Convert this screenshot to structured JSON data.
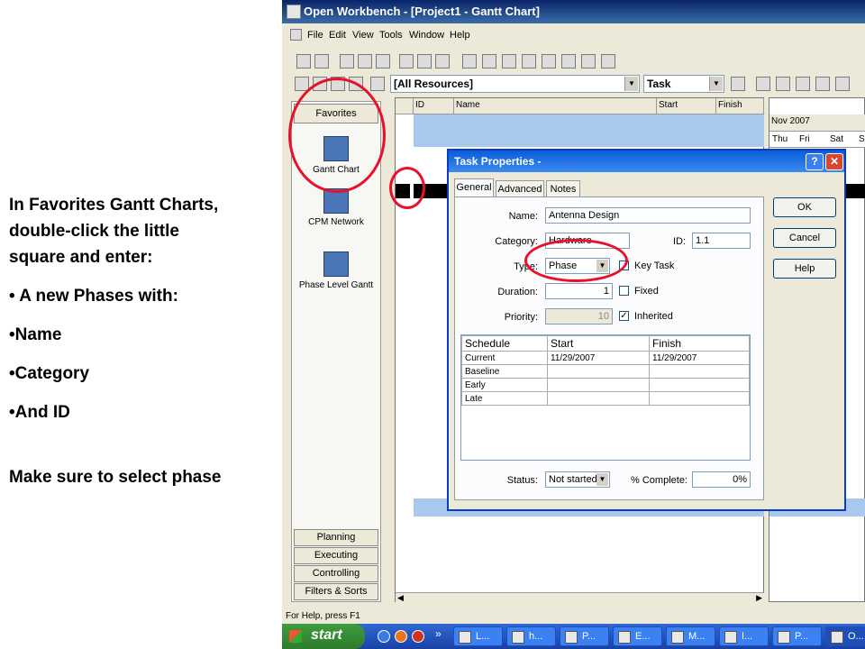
{
  "slide": {
    "line1": "In Favorites Gantt Charts,",
    "line2": "double-click the little",
    "line3": "square and enter:",
    "bullet1": "• A new Phases with:",
    "bullet2": "•Name",
    "bullet3": "•Category",
    "bullet4": "•And ID",
    "note": "Make sure to select phase"
  },
  "window": {
    "title": "Open Workbench - [Project1 - Gantt Chart]",
    "menu": [
      "File",
      "Edit",
      "View",
      "Tools",
      "Window",
      "Help"
    ],
    "resource_combo": "[All Resources]",
    "task_combo": "Task"
  },
  "favorites": {
    "header": "Favorites",
    "items": [
      "Gantt Chart",
      "CPM Network",
      "Phase Level Gantt"
    ],
    "bottom_buttons": [
      "Planning",
      "Executing",
      "Controlling",
      "Filters & Sorts"
    ]
  },
  "grid": {
    "columns": [
      "ID",
      "Name",
      "Start",
      "Finish"
    ],
    "gantt_month": "Nov 2007",
    "gantt_days": [
      "Thu",
      "Fri",
      "Sat",
      "Su"
    ]
  },
  "dialog": {
    "title": "Task Properties -",
    "tabs": [
      "General",
      "Advanced",
      "Notes"
    ],
    "labels": {
      "name": "Name:",
      "category": "Category:",
      "id": "ID:",
      "type": "Type:",
      "key_task": "Key Task",
      "duration": "Duration:",
      "fixed": "Fixed",
      "priority": "Priority:",
      "inherited": "Inherited",
      "status": "Status:",
      "complete": "% Complete:"
    },
    "values": {
      "name": "Antenna Design",
      "category": "Hardware",
      "id": "1.1",
      "type": "Phase",
      "duration": "1",
      "priority": "10",
      "status": "Not started",
      "complete": "0%",
      "inherited_check": "✓"
    },
    "schedule": {
      "headers": [
        "Schedule",
        "Start",
        "Finish"
      ],
      "rows": [
        [
          "Current",
          "11/29/2007",
          "11/29/2007"
        ],
        [
          "Baseline",
          "",
          ""
        ],
        [
          "Early",
          "",
          ""
        ],
        [
          "Late",
          "",
          ""
        ]
      ]
    },
    "buttons": [
      "OK",
      "Cancel",
      "Help"
    ]
  },
  "statusbar": {
    "text": "For Help, press F1"
  },
  "taskbar": {
    "start": "start",
    "chevron": "»",
    "tasks": [
      "L...",
      "h...",
      "P...",
      "E...",
      "M...",
      "I...",
      "P...",
      "O..."
    ]
  },
  "colors": {
    "highlight_circle": "#e8102a",
    "title_blue": "#0a246a",
    "dialog_blue": "#0b5dd7"
  }
}
